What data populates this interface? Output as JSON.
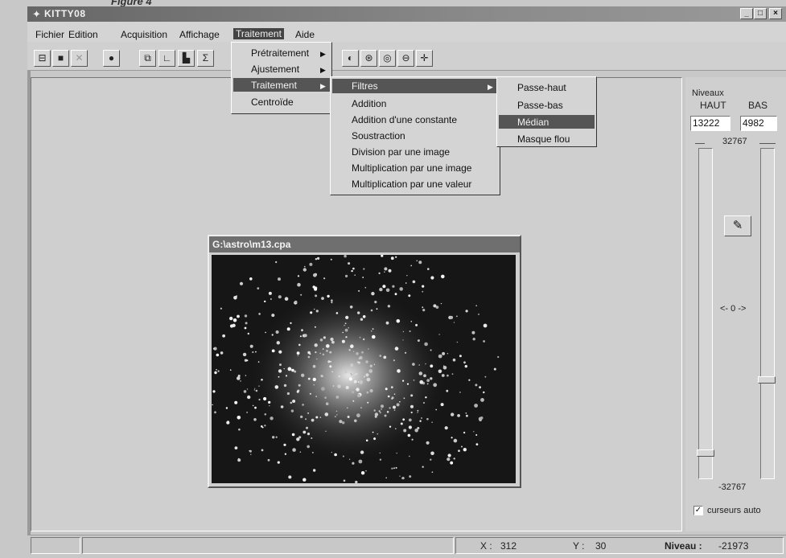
{
  "caption": "Figure 4",
  "window": {
    "title": "KITTY08",
    "controls": [
      "_",
      "□",
      "×"
    ]
  },
  "menubar": {
    "items": [
      "Fichier",
      "Edition",
      "Acquisition",
      "Affichage",
      "Traitement",
      "Aide"
    ],
    "active": "Traitement"
  },
  "toolbar": {
    "icons": [
      "open-icon",
      "save-icon",
      "close-doc-icon",
      "record-icon",
      "copy-icon",
      "curve-icon",
      "histogram-icon",
      "sigma-icon",
      "contrast-icon",
      "aperture-icon",
      "target-icon",
      "minus-circle-icon",
      "crosshair-icon"
    ]
  },
  "menu_traitement": {
    "items": [
      "Prétraitement",
      "Ajustement",
      "Traitement",
      "Centroïde"
    ]
  },
  "menu_traitement_sub": {
    "items": [
      "Filtres",
      "Addition",
      "Addition d'une constante",
      "Soustraction",
      "Division par une image",
      "Multiplication par une image",
      "Multiplication par une valeur"
    ]
  },
  "menu_filtres": {
    "items": [
      "Passe-haut",
      "Passe-bas",
      "Médian",
      "Masque flou"
    ],
    "highlighted": "Médian"
  },
  "image_window": {
    "title": "G:\\astro\\m13.cpa"
  },
  "levels": {
    "title": "Niveaux",
    "haut_label": "HAUT",
    "bas_label": "BAS",
    "haut_value": "13222",
    "bas_value": "4982",
    "max": "32767",
    "min": "-32767",
    "center": "<- 0 ->",
    "auto_label": "curseurs auto",
    "auto_checked": true,
    "left_slider_fraction": 0.08,
    "right_slider_fraction": 0.3
  },
  "status": {
    "x_label": "X :",
    "x_value": "312",
    "y_label": "Y :",
    "y_value": "30",
    "niveau_label": "Niveau :",
    "niveau_value": "-21973"
  }
}
